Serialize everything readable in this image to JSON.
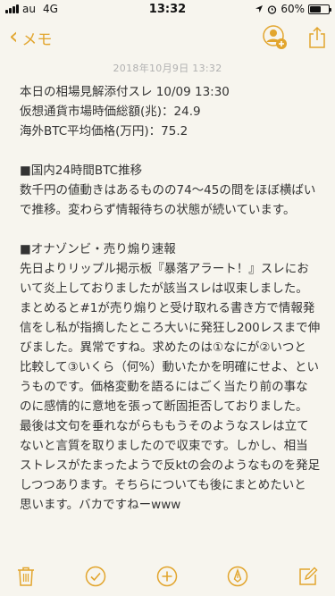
{
  "status": {
    "carrier": "au",
    "network": "4G",
    "time": "13:32",
    "battery_percent_label": "60%",
    "battery_level": 0.6
  },
  "nav": {
    "back_label": "メモ"
  },
  "note": {
    "timestamp": "2018年10月9日 13:32",
    "lines": [
      "本日の相場見解添付スレ 10/09 13:30",
      "仮想通貨市場時価総額(兆)：24.9",
      "海外BTC平均価格(万円)：75.2",
      "",
      "■国内24時間BTC推移",
      "数千円の値動きはあるものの74〜45の間をほぼ横ばい",
      "で推移。変わらず情報待ちの状態が続いています。",
      "",
      "■オナゾンビ・売り煽り速報",
      "先日よりリップル掲示板『暴落アラート！』スレにお",
      "いて炎上しておりましたが該当スレは収束しました。",
      "まとめると#1が売り煽りと受け取れる書き方で情報発",
      "信をし私が指摘したところ大いに発狂し200レスまで伸",
      "びました。異常ですね。求めたのは①なにが②いつと",
      "比較して③いくら（何%）動いたかを明確にせよ、とい",
      "うものです。価格変動を語るにはごく当たり前の事な",
      "のに感情的に意地を張って断固拒否しておりました。",
      "最後は文句を垂れながらももうそのようなスレは立て",
      "ないと言質を取りましたので収束です。しかし、相当",
      "ストレスがたまったようで反ktの会のようなものを発足",
      "しつつあります。そちらについても後にまとめたいと",
      "思います。バカですねーwww"
    ]
  },
  "colors": {
    "accent": "#e2a52d",
    "background": "#f7f5ee",
    "text": "#333333",
    "timestamp": "#b1b1b1"
  },
  "icons": {
    "nav": [
      "add-person-icon",
      "share-icon"
    ],
    "toolbar": [
      "trash-icon",
      "checklist-icon",
      "add-icon",
      "markup-icon",
      "compose-icon"
    ]
  }
}
